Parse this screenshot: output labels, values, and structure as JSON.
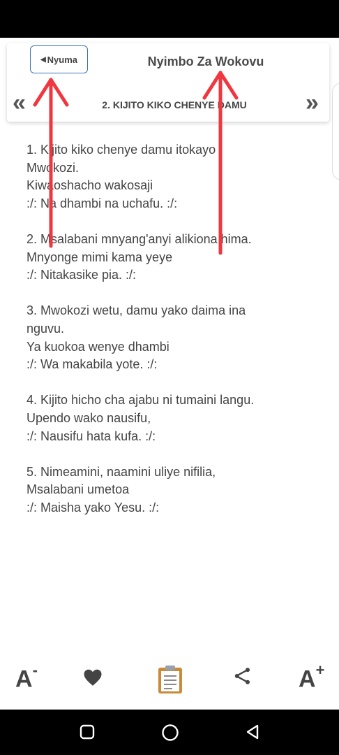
{
  "header": {
    "back_label": "Nyuma",
    "app_title": "Nyimbo Za Wokovu",
    "prev_symbol": "«",
    "next_symbol": "»",
    "song_title": "2. KIJITO KIKO CHENYE DAMU"
  },
  "lyrics": {
    "verses": [
      [
        "1. Kijito kiko chenye damu itokayo",
        "Mwokozi.",
        "Kiwaoshacho wakosaji",
        ":/: Na dhambi na uchafu. :/:"
      ],
      [
        "2. Msalabani mnyang'anyi alikiona hima.",
        "Mnyonge mimi kama yeye",
        ":/: Nitakasike pia. :/:"
      ],
      [
        "3. Mwokozi wetu, damu yako daima ina",
        "nguvu.",
        "Ya kuokoa wenye dhambi",
        ":/: Wa makabila yote. :/:"
      ],
      [
        "4. Kijito hicho cha ajabu ni tumaini langu.",
        "Upendo wako nausifu,",
        ":/: Nausifu hata kufa. :/:"
      ],
      [
        "5. Nimeamini, naamini uliye nifilia,",
        "Msalabani umetoa",
        ":/: Maisha yako Yesu. :/:"
      ]
    ]
  },
  "toolbar": {
    "font_decrease_label": "A",
    "font_decrease_mark": "-",
    "font_increase_label": "A",
    "font_increase_mark": "+",
    "icons": [
      "heart-icon",
      "clipboard-icon",
      "share-icon"
    ]
  },
  "colors": {
    "accent": "#3a73b7",
    "annotation_arrow": "#f0373f",
    "text": "#444444",
    "clipboard": "#c98a3a"
  }
}
